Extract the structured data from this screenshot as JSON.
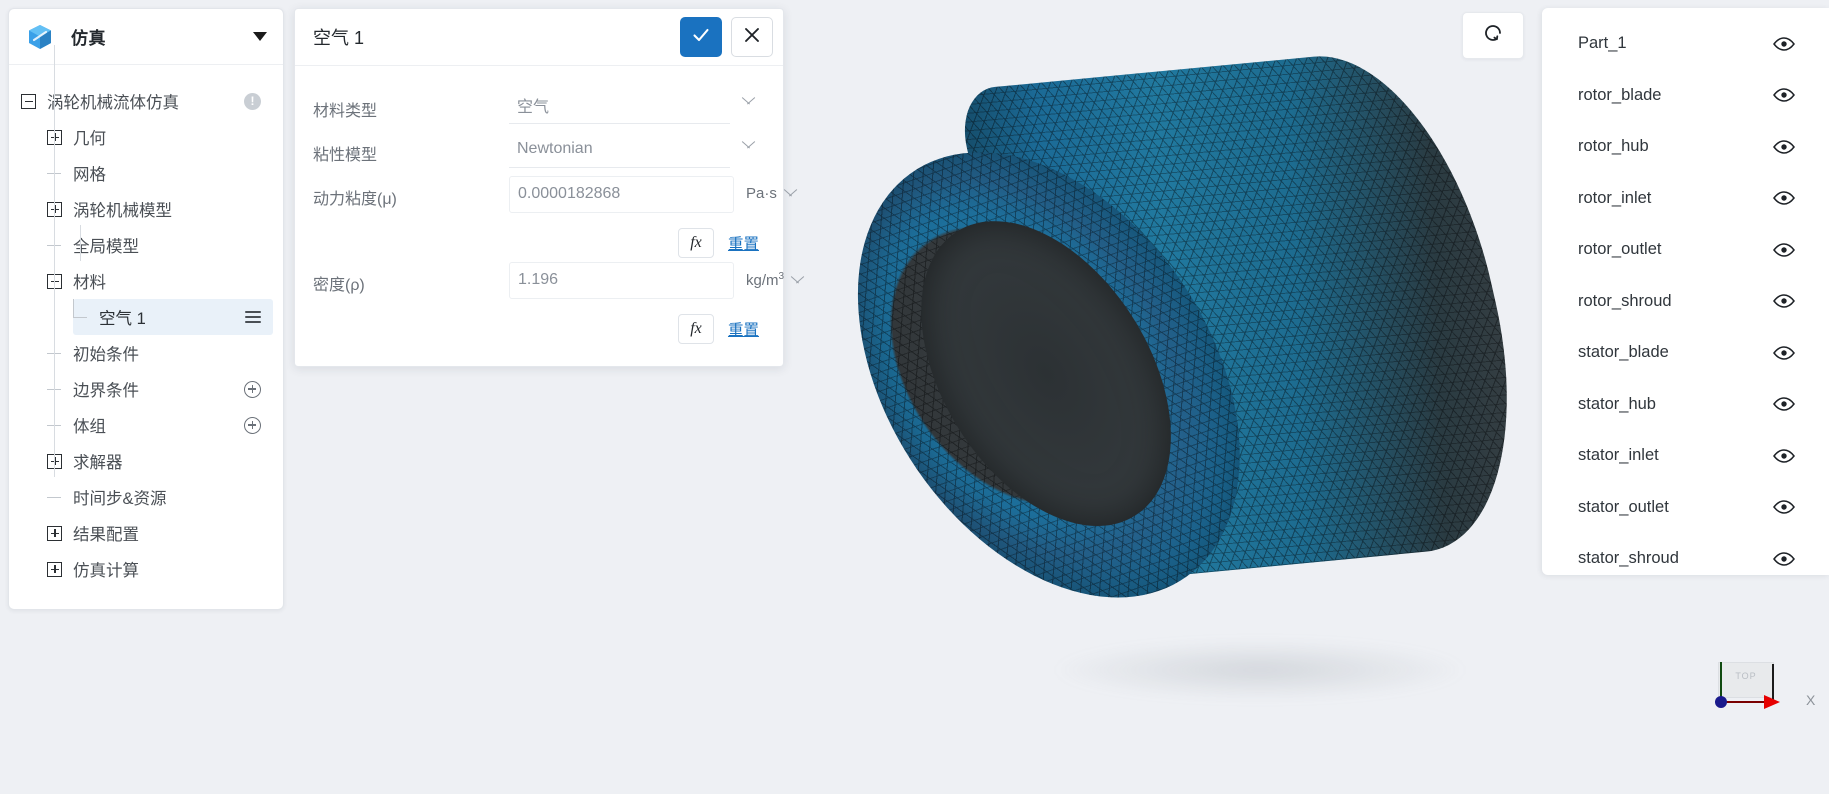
{
  "left_panel": {
    "header": {
      "icon": "cube-icon",
      "title": "仿真",
      "caret": "chevron-down-icon"
    },
    "tree": [
      {
        "label": "涡轮机械流体仿真",
        "toggle": "minus",
        "depth": 0,
        "badge": "!"
      },
      {
        "label": "几何",
        "toggle": "plus",
        "depth": 1
      },
      {
        "label": "网格",
        "toggle": "leaf",
        "depth": 1
      },
      {
        "label": "涡轮机械模型",
        "toggle": "plus",
        "depth": 1
      },
      {
        "label": "全局模型",
        "toggle": "leaf",
        "depth": 1
      },
      {
        "label": "材料",
        "toggle": "minus",
        "depth": 1
      },
      {
        "label": "空气 1",
        "toggle": "leaf",
        "depth": 2,
        "selected": true,
        "action": "hamburger"
      },
      {
        "label": "初始条件",
        "toggle": "leaf",
        "depth": 1
      },
      {
        "label": "边界条件",
        "toggle": "leaf",
        "depth": 1,
        "action": "plus-circle"
      },
      {
        "label": "体组",
        "toggle": "leaf",
        "depth": 1,
        "action": "plus-circle"
      },
      {
        "label": "求解器",
        "toggle": "plus",
        "depth": 1
      },
      {
        "label": "时间步&资源",
        "toggle": "leaf",
        "depth": 1
      },
      {
        "label": "结果配置",
        "toggle": "plus",
        "depth": 1
      },
      {
        "label": "仿真计算",
        "toggle": "plus",
        "depth": 1
      }
    ]
  },
  "dialog": {
    "title": "空气 1",
    "confirm_icon": "check-icon",
    "cancel_icon": "close-icon",
    "fields": [
      {
        "label": "材料类型",
        "value": "空气",
        "control": "select",
        "unit": null,
        "has_fx": false
      },
      {
        "label": "粘性模型",
        "value": "Newtonian",
        "control": "select",
        "unit": null,
        "has_fx": false
      },
      {
        "label": "动力粘度(μ)",
        "value": "0.0000182868",
        "control": "input",
        "unit": "Pa·s",
        "has_fx": true,
        "fx_label": "fx",
        "reset_label": "重置"
      },
      {
        "label": "密度(ρ)",
        "value": "1.196",
        "control": "input",
        "unit": "kg/m³",
        "unit_base": "kg/m",
        "unit_sup": "3",
        "has_fx": true,
        "fx_label": "fx",
        "reset_label": "重置"
      }
    ]
  },
  "viewport": {
    "reset_view_button": "rotate-icon",
    "axis_triad": {
      "plane_label": "TOP",
      "x_axis_label": "X"
    }
  },
  "parts_panel": {
    "items": [
      {
        "name": "Part_1",
        "visible": true
      },
      {
        "name": "rotor_blade",
        "visible": true
      },
      {
        "name": "rotor_hub",
        "visible": true
      },
      {
        "name": "rotor_inlet",
        "visible": true
      },
      {
        "name": "rotor_outlet",
        "visible": true
      },
      {
        "name": "rotor_shroud",
        "visible": true
      },
      {
        "name": "stator_blade",
        "visible": true
      },
      {
        "name": "stator_hub",
        "visible": true
      },
      {
        "name": "stator_inlet",
        "visible": true
      },
      {
        "name": "stator_outlet",
        "visible": true
      },
      {
        "name": "stator_shroud",
        "visible": true
      }
    ],
    "eye_icon": "eye-icon"
  },
  "colors": {
    "accent_blue": "#1a72c0",
    "selected_row_bg": "#e9f1f9",
    "mesh_blue": "#1b6a96",
    "mesh_wire": "#3a3f42",
    "viewport_bg": "#eef0f4",
    "link_blue": "#1a72c0"
  }
}
